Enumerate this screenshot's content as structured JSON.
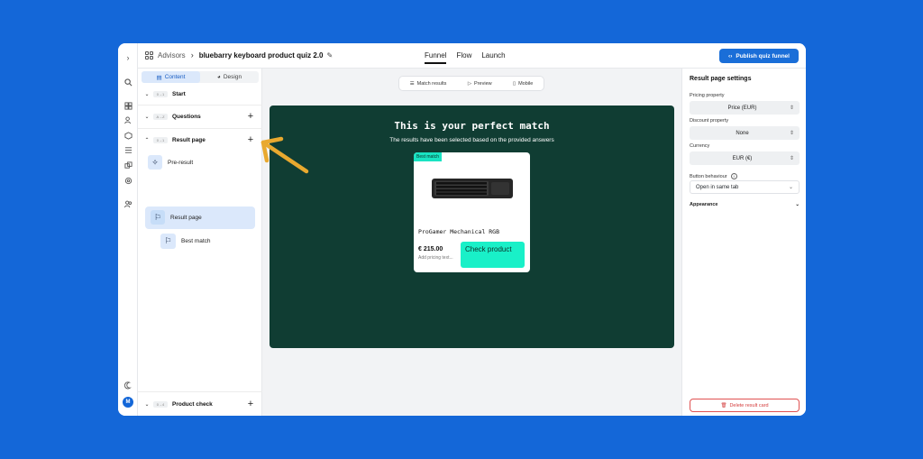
{
  "topbar": {
    "breadcrumb_root": "Advisors",
    "title": "bluebarry keyboard product quiz 2.0",
    "tabs": [
      "Funnel",
      "Flow",
      "Launch"
    ],
    "active_tab": "Funnel",
    "publish_label": "Publish quiz funnel"
  },
  "left": {
    "segments": [
      "Content",
      "Design"
    ],
    "active_segment": "Content",
    "sections": {
      "start": {
        "tag": "0→1",
        "label": "Start"
      },
      "questions": {
        "tag": "A→Z",
        "label": "Questions"
      },
      "result": {
        "tag": "0→1",
        "label": "Result page"
      },
      "product": {
        "tag": "0→4",
        "label": "Product check"
      }
    },
    "items": {
      "pre_result": "Pre-result",
      "result_page": "Result page",
      "best_match": "Best match"
    }
  },
  "rail": {
    "avatar": "M"
  },
  "canvas": {
    "view_options": [
      "Match results",
      "Preview",
      "Mobile"
    ],
    "headline": "This is your perfect match",
    "subtitle": "The results have been selected based on the provided answers",
    "card": {
      "badge": "Best match",
      "product_name": "ProGamer Mechanical RGB",
      "price": "€ 215.00",
      "price_note": "Add pricing text...",
      "cta": "Check product"
    }
  },
  "right": {
    "title": "Result page settings",
    "pricing_label": "Pricing property",
    "pricing_value": "Price (EUR)",
    "discount_label": "Discount property",
    "discount_value": "None",
    "currency_label": "Currency",
    "currency_value": "EUR (€)",
    "button_label": "Button behaviour",
    "button_value": "Open in same tab",
    "appearance_label": "Appearance",
    "delete_label": "Delete result card"
  },
  "colors": {
    "background": "#1467d8",
    "accent": "#1a6ed8",
    "stage": "#103d33",
    "cta": "#19f0c8",
    "annotation_arrow": "#e9a92f",
    "danger": "#d43c3c"
  }
}
